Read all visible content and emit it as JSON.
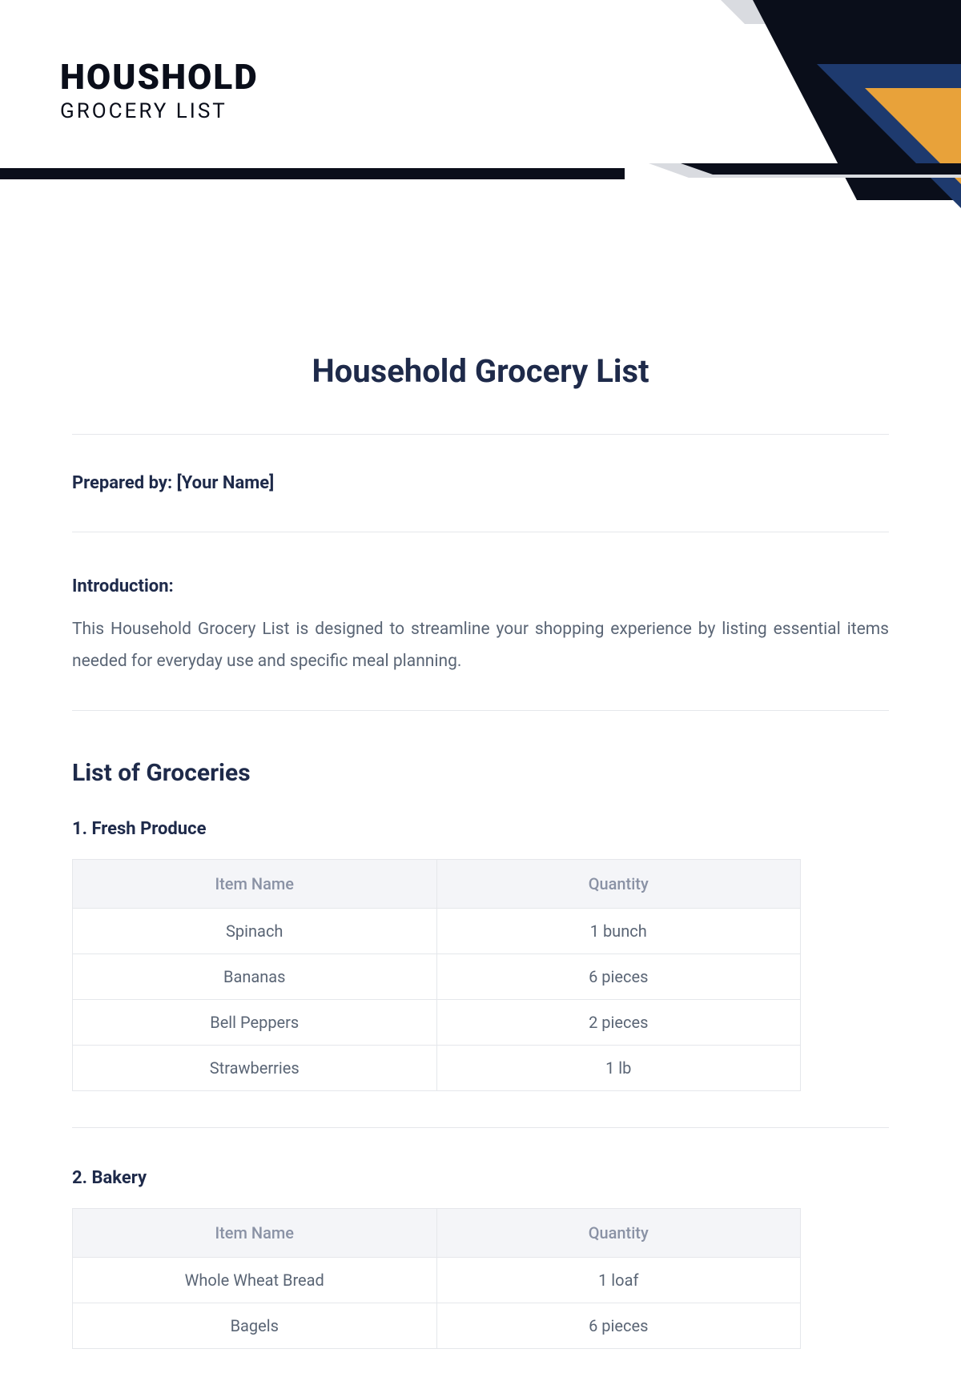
{
  "logo": {
    "main": "HOUSHOLD",
    "sub": "GROCERY LIST"
  },
  "page_title": "Household Grocery List",
  "prepared_by_label": "Prepared by: ",
  "prepared_by_value": "[Your Name]",
  "intro_label": "Introduction:",
  "intro_text": "This Household Grocery List is designed to streamline your shopping experience by listing essential items needed for everyday use and specific meal planning.",
  "section_title": "List of Groceries",
  "columns": {
    "item": "Item Name",
    "qty": "Quantity"
  },
  "categories": [
    {
      "heading": "1. Fresh Produce",
      "rows": [
        {
          "item": "Spinach",
          "qty": "1 bunch"
        },
        {
          "item": "Bananas",
          "qty": "6 pieces"
        },
        {
          "item": "Bell Peppers",
          "qty": "2 pieces"
        },
        {
          "item": "Strawberries",
          "qty": "1 lb"
        }
      ]
    },
    {
      "heading": "2. Bakery",
      "rows": [
        {
          "item": "Whole Wheat Bread",
          "qty": "1 loaf"
        },
        {
          "item": "Bagels",
          "qty": "6 pieces"
        }
      ]
    }
  ]
}
